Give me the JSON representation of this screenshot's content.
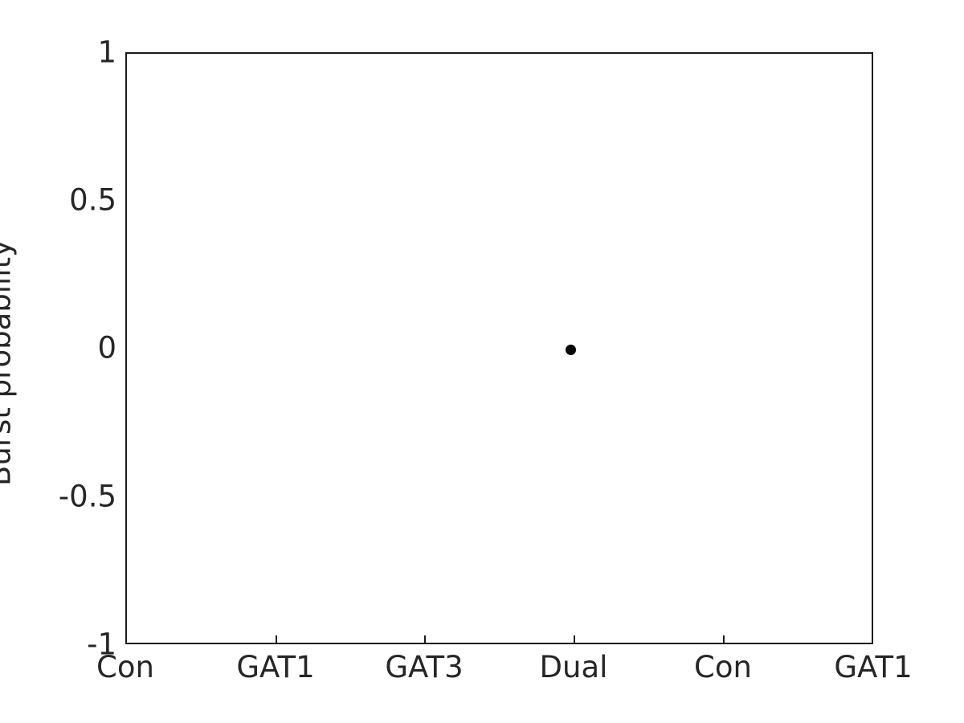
{
  "chart_data": {
    "type": "scatter",
    "title": "",
    "xlabel": "",
    "ylabel": "Burst probability",
    "categories": [
      "Con",
      "GAT1",
      "GAT3",
      "Dual",
      "Con",
      "GAT1"
    ],
    "x_tick_labels": [
      "Con",
      "GAT1",
      "GAT3",
      "Dual",
      "Con",
      "GAT1"
    ],
    "y_tick_labels": [
      "1",
      "0.5",
      "0",
      "-0.5",
      "-1"
    ],
    "y_tick_values": [
      1,
      0.5,
      0,
      -0.5,
      -1
    ],
    "ylim": [
      -1,
      1
    ],
    "xlim": [
      0,
      5
    ],
    "grid": false,
    "legend": null,
    "series": [
      {
        "name": "burst probability",
        "marker": "filled-circle",
        "color": "#000000",
        "points": [
          {
            "category": "Dual",
            "x": 3,
            "y": 0,
            "label": "0"
          }
        ]
      }
    ],
    "notes": "Single black filled circle marker plotted at the Dual category at y = 0; no other data drawn."
  },
  "axes": {
    "frame_color": "#1a1a1a",
    "text_color": "#262626",
    "background": "#ffffff"
  }
}
